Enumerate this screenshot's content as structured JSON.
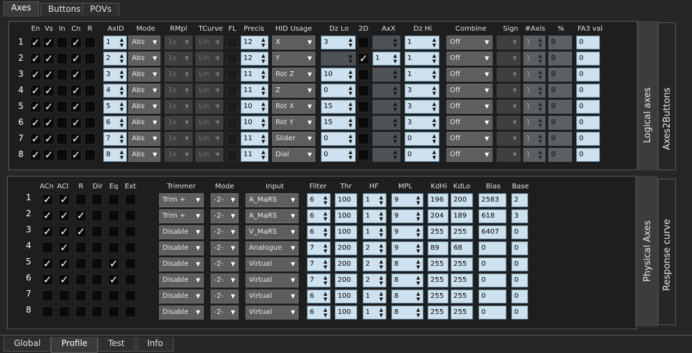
{
  "top_tabs": [
    "Axes",
    "Buttons",
    "POVs"
  ],
  "bottom_tabs": [
    "Global",
    "Profile",
    "Test",
    "Info"
  ],
  "logical": {
    "side_label_1": "Logical axes",
    "side_label_2": "Axes2Buttons",
    "headers": {
      "en": "En",
      "vs": "Vs",
      "in": "In",
      "cn": "Cn",
      "r": "R",
      "axid": "AxID",
      "mode": "Mode",
      "rmpl": "RMpl",
      "tcurve": "TCurve",
      "fl": "FL",
      "precis": "Precis",
      "hid": "HID Usage",
      "dzlo": "Dz Lo",
      "d2": "2D",
      "axx": "AxX",
      "dzhi": "Dz Hi",
      "combine": "Combine",
      "sign": "Sign",
      "naxis": "#Axis",
      "pct": "%",
      "fa3": "FA3 val"
    },
    "rows": [
      {
        "num": "1",
        "en": true,
        "vs": true,
        "in": false,
        "cn": true,
        "r": false,
        "axid": "1",
        "mode": "Abs",
        "rmpl": "1x",
        "tcurve": "Lin",
        "precis": "12",
        "hid": "X",
        "dzlo": "3",
        "d2": false,
        "axx": "",
        "dzhi": "1",
        "combine": "Off",
        "sign": "-",
        "naxis": "1",
        "pct": "0",
        "fa3": "0"
      },
      {
        "num": "2",
        "en": true,
        "vs": true,
        "in": false,
        "cn": true,
        "r": false,
        "axid": "2",
        "mode": "Abs",
        "rmpl": "1x",
        "tcurve": "Lin",
        "precis": "12",
        "hid": "Y",
        "dzlo": "",
        "d2": true,
        "axx": "1",
        "dzhi": "1",
        "combine": "Off",
        "sign": "-",
        "naxis": "1",
        "pct": "0",
        "fa3": "0"
      },
      {
        "num": "3",
        "en": true,
        "vs": true,
        "in": false,
        "cn": true,
        "r": false,
        "axid": "3",
        "mode": "Abs",
        "rmpl": "1x",
        "tcurve": "Lin",
        "precis": "11",
        "hid": "Rot Z",
        "dzlo": "10",
        "d2": false,
        "axx": "",
        "dzhi": "1",
        "combine": "Off",
        "sign": "-",
        "naxis": "1",
        "pct": "0",
        "fa3": "0"
      },
      {
        "num": "4",
        "en": true,
        "vs": true,
        "in": false,
        "cn": true,
        "r": false,
        "axid": "4",
        "mode": "Abs",
        "rmpl": "1x",
        "tcurve": "Lin",
        "precis": "11",
        "hid": "Z",
        "dzlo": "0",
        "d2": false,
        "axx": "",
        "dzhi": "3",
        "combine": "Off",
        "sign": "-",
        "naxis": "1",
        "pct": "0",
        "fa3": "0"
      },
      {
        "num": "5",
        "en": true,
        "vs": true,
        "in": false,
        "cn": true,
        "r": false,
        "axid": "5",
        "mode": "Abs",
        "rmpl": "1x",
        "tcurve": "Lin",
        "precis": "10",
        "hid": "Rot X",
        "dzlo": "15",
        "d2": false,
        "axx": "",
        "dzhi": "3",
        "combine": "Off",
        "sign": "-",
        "naxis": "1",
        "pct": "0",
        "fa3": "0"
      },
      {
        "num": "6",
        "en": true,
        "vs": true,
        "in": false,
        "cn": true,
        "r": false,
        "axid": "6",
        "mode": "Abs",
        "rmpl": "1x",
        "tcurve": "Lin",
        "precis": "10",
        "hid": "Rot Y",
        "dzlo": "15",
        "d2": false,
        "axx": "",
        "dzhi": "3",
        "combine": "Off",
        "sign": "-",
        "naxis": "1",
        "pct": "0",
        "fa3": "0"
      },
      {
        "num": "7",
        "en": true,
        "vs": true,
        "in": false,
        "cn": true,
        "r": false,
        "axid": "7",
        "mode": "Abs",
        "rmpl": "1x",
        "tcurve": "Lin",
        "precis": "11",
        "hid": "Slider",
        "dzlo": "0",
        "d2": false,
        "axx": "",
        "dzhi": "0",
        "combine": "Off",
        "sign": "-",
        "naxis": "1",
        "pct": "0",
        "fa3": "0"
      },
      {
        "num": "8",
        "en": true,
        "vs": true,
        "in": false,
        "cn": true,
        "r": false,
        "axid": "8",
        "mode": "Abs",
        "rmpl": "1x",
        "tcurve": "Lin",
        "precis": "11",
        "hid": "Dial",
        "dzlo": "0",
        "d2": false,
        "axx": "",
        "dzhi": "0",
        "combine": "Off",
        "sign": "-",
        "naxis": "1",
        "pct": "0",
        "fa3": "0"
      }
    ]
  },
  "physical": {
    "side_label_1": "Physical Axes",
    "side_label_2": "Response curve",
    "headers": {
      "acn": "ACn",
      "acl": "ACl",
      "r": "R",
      "dir": "Dir",
      "eq": "Eq",
      "ext": "Ext",
      "trimmer": "Trimmer",
      "mode": "Mode",
      "input": "Input",
      "filter": "Filter",
      "thr": "Thr",
      "hf": "HF",
      "mpl": "MPL",
      "kdhi": "KdHi",
      "kdlo": "KdLo",
      "bias": "Bias",
      "base": "Base"
    },
    "rows": [
      {
        "num": "1",
        "acn": true,
        "acl": true,
        "r": false,
        "dir": false,
        "eq": false,
        "ext": false,
        "trimmer": "Trim +",
        "mode": "-2-",
        "input": "A_MaRS",
        "filter": "6",
        "thr": "100",
        "hf": "1",
        "mpl": "9",
        "kdhi": "196",
        "kdlo": "200",
        "bias": "2583",
        "base": "2"
      },
      {
        "num": "2",
        "acn": true,
        "acl": true,
        "r": true,
        "dir": false,
        "eq": false,
        "ext": false,
        "trimmer": "Trim +",
        "mode": "-2-",
        "input": "A_MaRS",
        "filter": "6",
        "thr": "100",
        "hf": "1",
        "mpl": "9",
        "kdhi": "204",
        "kdlo": "189",
        "bias": "618",
        "base": "3"
      },
      {
        "num": "3",
        "acn": true,
        "acl": true,
        "r": true,
        "dir": false,
        "eq": false,
        "ext": false,
        "trimmer": "Disable",
        "mode": "-2-",
        "input": "V_MaRS",
        "filter": "6",
        "thr": "100",
        "hf": "1",
        "mpl": "9",
        "kdhi": "255",
        "kdlo": "255",
        "bias": "6407",
        "base": "0"
      },
      {
        "num": "4",
        "acn": false,
        "acl": true,
        "r": false,
        "dir": false,
        "eq": false,
        "ext": false,
        "trimmer": "Disable",
        "mode": "-2-",
        "input": "Analogue",
        "filter": "7",
        "thr": "200",
        "hf": "2",
        "mpl": "9",
        "kdhi": "89",
        "kdlo": "68",
        "bias": "0",
        "base": "0"
      },
      {
        "num": "5",
        "acn": true,
        "acl": true,
        "r": false,
        "dir": false,
        "eq": true,
        "ext": false,
        "trimmer": "Disable",
        "mode": "-2-",
        "input": "Virtual",
        "filter": "7",
        "thr": "200",
        "hf": "2",
        "mpl": "8",
        "kdhi": "255",
        "kdlo": "255",
        "bias": "0",
        "base": "0"
      },
      {
        "num": "6",
        "acn": true,
        "acl": true,
        "r": false,
        "dir": false,
        "eq": true,
        "ext": false,
        "trimmer": "Disable",
        "mode": "-2-",
        "input": "Virtual",
        "filter": "7",
        "thr": "200",
        "hf": "2",
        "mpl": "8",
        "kdhi": "255",
        "kdlo": "255",
        "bias": "0",
        "base": "0"
      },
      {
        "num": "7",
        "acn": false,
        "acl": false,
        "r": false,
        "dir": false,
        "eq": false,
        "ext": false,
        "trimmer": "Disable",
        "mode": "-2-",
        "input": "Virtual",
        "filter": "6",
        "thr": "100",
        "hf": "1",
        "mpl": "8",
        "kdhi": "255",
        "kdlo": "255",
        "bias": "0",
        "base": "0"
      },
      {
        "num": "8",
        "acn": false,
        "acl": false,
        "r": false,
        "dir": false,
        "eq": false,
        "ext": false,
        "trimmer": "Disable",
        "mode": "-2-",
        "input": "Virtual",
        "filter": "6",
        "thr": "100",
        "hf": "1",
        "mpl": "8",
        "kdhi": "255",
        "kdlo": "255",
        "bias": "0",
        "base": "0"
      }
    ]
  },
  "glyphs": {
    "check": "✓",
    "up": "▲",
    "down": "▼",
    "dropdown": "▼"
  },
  "colors": {
    "field_bg": "#cde1ee",
    "disabled_field": "#5a5f64",
    "dropdown_bg": "#5e5e5e",
    "panel_bg": "#1e1e1e",
    "window_bg": "#262626"
  }
}
